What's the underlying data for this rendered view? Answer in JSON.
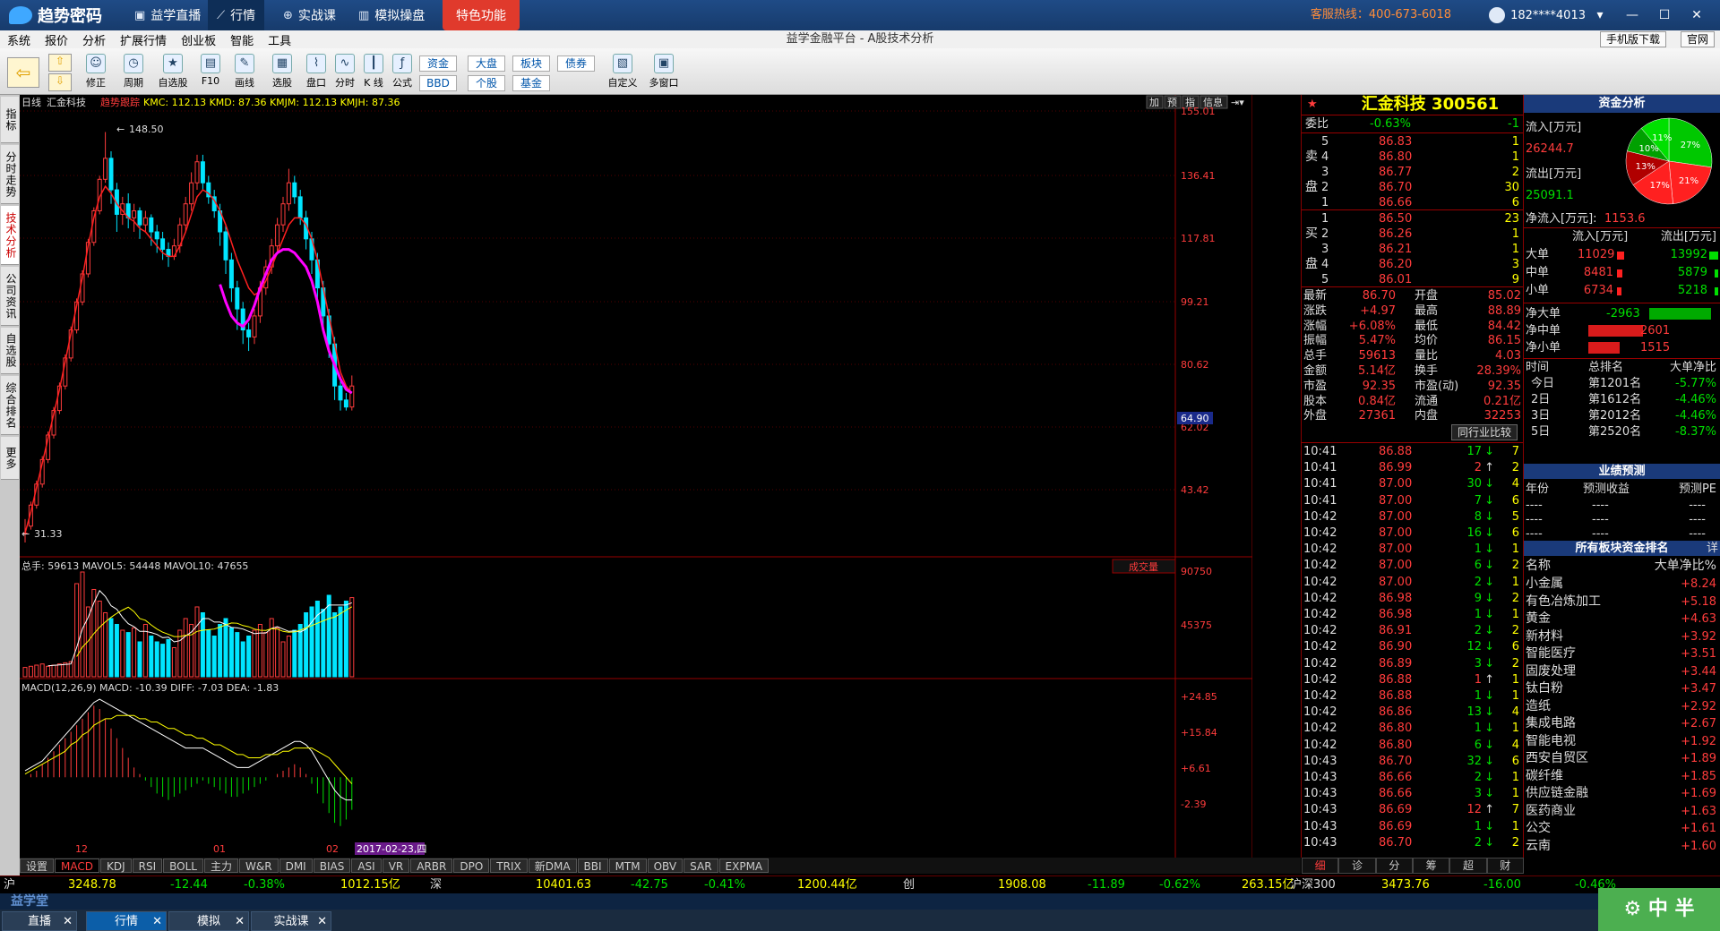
{
  "header": {
    "logo_text": "趋势密码",
    "nav": [
      "益学直播",
      "行情",
      "实战课",
      "模拟操盘"
    ],
    "special": "特色功能",
    "hotline": "客服热线：400-673-6018",
    "user": "182****4013",
    "window_controls": [
      "▾",
      "—",
      "☐",
      "✕"
    ]
  },
  "menu": {
    "items": [
      "系统",
      "报价",
      "分析",
      "扩展行情",
      "创业板",
      "智能",
      "工具"
    ],
    "platform_title": "益学金融平台 - A股技术分析",
    "right_buttons": [
      "手机版下载",
      "官网"
    ]
  },
  "toolbar": {
    "buttons": [
      "修正",
      "周期",
      "自选股",
      "F10",
      "画线",
      "选股",
      "盘口",
      "分时",
      "K 线",
      "公式"
    ],
    "small": [
      "资金",
      "BBD",
      "大盘",
      "个股",
      "板块",
      "基金",
      "债券"
    ],
    "right": [
      "自定义",
      "多窗口"
    ]
  },
  "left_tabs": [
    "指标",
    "分时走势",
    "技术分析",
    "公司资讯",
    "自选股",
    "综合排名",
    "更多"
  ],
  "chart": {
    "title_row": {
      "period": "日线",
      "name": "汇金科技",
      "indicator": "趋势跟踪",
      "values": "KMC: 112.13  KMD: 87.36  KMJM: 112.13  KMJH: 87.36"
    },
    "top_buttons": [
      "加",
      "预",
      "指",
      "信息"
    ],
    "price_axis": [
      "155.01",
      "136.41",
      "117.81",
      "99.21",
      "80.62",
      "62.02",
      "43.42"
    ],
    "current_price_tag": "64.90",
    "high_label": "148.50",
    "low_label": "31.33",
    "vol_header": "总手: 59613  MAVOL5: 54448  MAVOL10: 47655",
    "vol_selector": "成交量",
    "vol_axis": [
      "90750",
      "45375"
    ],
    "macd_header": "MACD(12,26,9)  MACD: -10.39  DIFF: -7.03  DEA: -1.83",
    "macd_axis": [
      "+24.85",
      "+15.84",
      "+6.61",
      "-2.39"
    ],
    "x_labels": [
      "12",
      "01",
      "02"
    ],
    "cursor_date": "2017-02-23,四"
  },
  "chart_data": {
    "type": "candlestick",
    "ylim": [
      31.33,
      155.01
    ],
    "candles": [
      [
        34,
        34,
        31.33,
        38
      ],
      [
        36,
        42,
        35,
        43
      ],
      [
        42,
        48,
        41,
        49
      ],
      [
        48,
        55,
        47,
        56
      ],
      [
        55,
        62,
        54,
        63
      ],
      [
        62,
        69,
        61,
        70
      ],
      [
        69,
        76,
        68,
        77
      ],
      [
        76,
        84,
        75,
        85
      ],
      [
        84,
        92,
        83,
        93
      ],
      [
        92,
        100,
        91,
        101
      ],
      [
        100,
        108,
        99,
        109
      ],
      [
        108,
        117,
        107,
        118
      ],
      [
        117,
        126,
        116,
        127
      ],
      [
        126,
        135,
        125,
        136
      ],
      [
        135,
        141,
        134,
        148.5
      ],
      [
        141,
        132,
        128,
        143
      ],
      [
        132,
        125,
        120,
        134
      ],
      [
        125,
        128,
        122,
        130
      ],
      [
        128,
        124,
        121,
        131
      ],
      [
        124,
        126,
        120,
        128
      ],
      [
        126,
        122,
        118,
        127
      ],
      [
        122,
        124,
        120,
        126
      ],
      [
        124,
        120,
        116,
        125
      ],
      [
        120,
        118,
        114,
        122
      ],
      [
        118,
        115,
        112,
        120
      ],
      [
        115,
        113,
        110,
        117
      ],
      [
        113,
        116,
        112,
        118
      ],
      [
        116,
        122,
        114,
        124
      ],
      [
        122,
        128,
        120,
        130
      ],
      [
        128,
        134,
        126,
        137
      ],
      [
        134,
        140,
        132,
        142
      ],
      [
        140,
        134,
        132,
        142
      ],
      [
        134,
        130,
        128,
        136
      ],
      [
        130,
        126,
        124,
        132
      ],
      [
        126,
        120,
        116,
        128
      ],
      [
        120,
        112,
        108,
        122
      ],
      [
        112,
        104,
        100,
        114
      ],
      [
        104,
        98,
        92,
        106
      ],
      [
        98,
        92,
        88,
        100
      ],
      [
        92,
        90,
        86,
        94
      ],
      [
        90,
        96,
        88,
        98
      ],
      [
        96,
        104,
        94,
        106
      ],
      [
        104,
        110,
        102,
        112
      ],
      [
        110,
        116,
        108,
        118
      ],
      [
        116,
        122,
        114,
        124
      ],
      [
        122,
        128,
        120,
        130
      ],
      [
        128,
        134,
        126,
        138
      ],
      [
        134,
        130,
        128,
        136
      ],
      [
        130,
        124,
        122,
        132
      ],
      [
        124,
        118,
        115,
        126
      ],
      [
        118,
        112,
        108,
        120
      ],
      [
        112,
        104,
        100,
        114
      ],
      [
        104,
        96,
        92,
        106
      ],
      [
        96,
        88,
        84,
        98
      ],
      [
        88,
        76,
        72,
        90
      ],
      [
        76,
        72,
        69,
        78
      ],
      [
        72,
        70,
        69,
        74
      ],
      [
        70,
        76,
        69,
        79
      ]
    ],
    "kmc": [
      34,
      40,
      47,
      54,
      61,
      68,
      75,
      83,
      91,
      99,
      107,
      116,
      124,
      130,
      133,
      131,
      128,
      126,
      124,
      123,
      121,
      120,
      118,
      116,
      114,
      113,
      113,
      116,
      120,
      125,
      130,
      132,
      131,
      129,
      126,
      122,
      117,
      112,
      108,
      104,
      102,
      103,
      106,
      110,
      114,
      118,
      122,
      124,
      124,
      122,
      118,
      112,
      104,
      96,
      88,
      80,
      76,
      74
    ],
    "kmd": [
      null,
      null,
      null,
      null,
      null,
      null,
      null,
      null,
      null,
      null,
      null,
      null,
      null,
      null,
      null,
      null,
      null,
      null,
      null,
      null,
      null,
      null,
      null,
      null,
      null,
      null,
      null,
      null,
      null,
      null,
      null,
      null,
      null,
      null,
      105,
      100,
      96,
      94,
      93,
      95,
      99,
      104,
      108,
      112,
      114,
      115,
      115,
      114,
      112,
      110,
      106,
      100,
      92,
      86,
      82,
      78,
      75,
      74
    ],
    "volume": [
      8000,
      9000,
      10000,
      11000,
      9000,
      10000,
      11000,
      12000,
      13000,
      80000,
      90000,
      60000,
      75000,
      65000,
      55000,
      50000,
      45000,
      40000,
      38000,
      42000,
      30000,
      45000,
      35000,
      30000,
      28000,
      32000,
      25000,
      40000,
      50000,
      45000,
      60000,
      55000,
      40000,
      35000,
      45000,
      50000,
      42000,
      38000,
      30000,
      35000,
      40000,
      45000,
      38000,
      50000,
      42000,
      30000,
      35000,
      40000,
      45000,
      55000,
      60000,
      65000,
      58000,
      70000,
      55000,
      60000,
      65000,
      68000
    ],
    "macd_hist": [
      0,
      1,
      2,
      4,
      6,
      8,
      10,
      12,
      14,
      16,
      18,
      20,
      22,
      21,
      18,
      15,
      12,
      9,
      6,
      3,
      1,
      -1,
      -3,
      -5,
      -6,
      -7,
      -6,
      -5,
      -4,
      -3,
      -2,
      -1,
      -2,
      -3,
      -4,
      -5,
      -6,
      -6,
      -5,
      -4,
      -3,
      -2,
      -1,
      0,
      1,
      2,
      3,
      4,
      3,
      1,
      -2,
      -5,
      -8,
      -11,
      -14,
      -15,
      -13,
      -10
    ],
    "macd_diff": [
      2,
      3,
      4,
      5,
      7,
      9,
      11,
      13,
      15,
      17,
      19,
      21,
      23,
      24,
      23,
      22,
      21,
      20,
      19,
      18,
      17,
      16,
      15,
      14,
      13,
      12,
      11,
      10,
      9,
      9,
      9,
      9,
      8,
      7,
      6,
      5,
      4,
      3,
      3,
      3,
      4,
      5,
      6,
      7,
      8,
      9,
      10,
      11,
      11,
      10,
      8,
      5,
      2,
      -1,
      -4,
      -6,
      -7,
      -7
    ],
    "macd_dea": [
      1,
      2,
      3,
      4,
      5,
      6,
      7,
      8,
      10,
      11,
      13,
      14,
      16,
      17,
      18,
      18,
      19,
      19,
      19,
      19,
      18,
      18,
      17,
      17,
      16,
      15,
      15,
      14,
      13,
      13,
      12,
      12,
      11,
      10,
      10,
      9,
      8,
      7,
      7,
      6,
      6,
      6,
      7,
      7,
      7,
      8,
      8,
      9,
      9,
      9,
      9,
      8,
      7,
      6,
      4,
      2,
      0,
      -2
    ]
  },
  "quote": {
    "title": "汇金科技 300561",
    "weibi_label": "委比",
    "weibi_value": "-0.63%",
    "weibi_diff": "-1",
    "sell_label": [
      "卖",
      "盘"
    ],
    "buy_label": [
      "买",
      "盘"
    ],
    "asks": [
      [
        "5",
        "86.83",
        "1"
      ],
      [
        "4",
        "86.80",
        "1"
      ],
      [
        "3",
        "86.77",
        "2"
      ],
      [
        "2",
        "86.70",
        "30"
      ],
      [
        "1",
        "86.66",
        "6"
      ]
    ],
    "bids": [
      [
        "1",
        "86.50",
        "23"
      ],
      [
        "2",
        "86.26",
        "1"
      ],
      [
        "3",
        "86.21",
        "1"
      ],
      [
        "4",
        "86.20",
        "3"
      ],
      [
        "5",
        "86.01",
        "9"
      ]
    ],
    "stats": [
      [
        "最新",
        "86.70",
        "开盘",
        "85.02"
      ],
      [
        "涨跌",
        "+4.97",
        "最高",
        "88.89"
      ],
      [
        "涨幅",
        "+6.08%",
        "最低",
        "84.42"
      ],
      [
        "振幅",
        "5.47%",
        "均价",
        "86.15"
      ],
      [
        "总手",
        "59613",
        "量比",
        "4.03"
      ],
      [
        "金额",
        "5.14亿",
        "换手",
        "28.39%"
      ],
      [
        "市盈",
        "92.35",
        "市盈(动)",
        "92.35"
      ],
      [
        "股本",
        "0.84亿",
        "流通",
        "0.21亿"
      ],
      [
        "外盘",
        "27361",
        "内盘",
        "32253"
      ]
    ],
    "peer_button": "同行业比较",
    "ticks": [
      [
        "10:41",
        "86.88",
        "17",
        "↓",
        "7"
      ],
      [
        "10:41",
        "86.99",
        "2",
        "↑",
        "2"
      ],
      [
        "10:41",
        "87.00",
        "30",
        "↓",
        "4"
      ],
      [
        "10:41",
        "87.00",
        "7",
        "↓",
        "6"
      ],
      [
        "10:42",
        "87.00",
        "8",
        "↓",
        "5"
      ],
      [
        "10:42",
        "87.00",
        "16",
        "↓",
        "6"
      ],
      [
        "10:42",
        "87.00",
        "1",
        "↓",
        "1"
      ],
      [
        "10:42",
        "87.00",
        "6",
        "↓",
        "2"
      ],
      [
        "10:42",
        "87.00",
        "2",
        "↓",
        "1"
      ],
      [
        "10:42",
        "86.98",
        "9",
        "↓",
        "2"
      ],
      [
        "10:42",
        "86.98",
        "1",
        "↓",
        "1"
      ],
      [
        "10:42",
        "86.91",
        "2",
        "↓",
        "2"
      ],
      [
        "10:42",
        "86.90",
        "12",
        "↓",
        "6"
      ],
      [
        "10:42",
        "86.89",
        "3",
        "↓",
        "2"
      ],
      [
        "10:42",
        "86.88",
        "1",
        "↑",
        "1"
      ],
      [
        "10:42",
        "86.88",
        "1",
        "↓",
        "1"
      ],
      [
        "10:42",
        "86.86",
        "13",
        "↓",
        "4"
      ],
      [
        "10:42",
        "86.80",
        "1",
        "↓",
        "1"
      ],
      [
        "10:42",
        "86.80",
        "6",
        "↓",
        "4"
      ],
      [
        "10:43",
        "86.70",
        "32",
        "↓",
        "6"
      ],
      [
        "10:43",
        "86.66",
        "2",
        "↓",
        "1"
      ],
      [
        "10:43",
        "86.66",
        "3",
        "↓",
        "1"
      ],
      [
        "10:43",
        "86.69",
        "12",
        "↑",
        "7"
      ],
      [
        "10:43",
        "86.69",
        "1",
        "↓",
        "1"
      ],
      [
        "10:43",
        "86.70",
        "2",
        "↓",
        "2"
      ]
    ],
    "bottom_tabs": [
      "细",
      "诊",
      "分",
      "筹",
      "超",
      "财"
    ]
  },
  "fund": {
    "title": "资金分析",
    "inflow_label": "流入[万元]",
    "inflow_value": "26244.7",
    "outflow_label": "流出[万元]",
    "outflow_value": "25091.1",
    "net_label": "净流入[万元]:",
    "net_value": "1153.6",
    "pie": [
      {
        "v": 27,
        "c": "#00c800"
      },
      {
        "v": 21,
        "c": "#ff2020"
      },
      {
        "v": 17,
        "c": "#ff2020"
      },
      {
        "v": 13,
        "c": "#b00000"
      },
      {
        "v": 10,
        "c": "#00a000"
      },
      {
        "v": 11,
        "c": "#00e000"
      }
    ],
    "pie_labels": [
      "27%",
      "21%",
      "17%",
      "13%",
      "10%",
      "11%"
    ],
    "flow_header": [
      "流入[万元]",
      "流出[万元]"
    ],
    "flows": [
      [
        "大单",
        "11029",
        "13992"
      ],
      [
        "中单",
        "8481",
        "5879"
      ],
      [
        "小单",
        "6734",
        "5218"
      ]
    ],
    "net_items": [
      [
        "净大单",
        "-2963"
      ],
      [
        "净中单",
        "2601"
      ],
      [
        "净小单",
        "1515"
      ]
    ],
    "rank_header": [
      "时间",
      "总排名",
      "大单净比"
    ],
    "ranks": [
      [
        "今日",
        "第1201名",
        "-5.77%"
      ],
      [
        "2日",
        "第1612名",
        "-4.46%"
      ],
      [
        "3日",
        "第2012名",
        "-4.46%"
      ],
      [
        "5日",
        "第2520名",
        "-8.37%"
      ]
    ],
    "forecast_title": "业绩预测",
    "forecast_header": [
      "年份",
      "预测收益",
      "预测PE"
    ],
    "forecast_rows": [
      [
        "----",
        "----",
        "----"
      ],
      [
        "----",
        "----",
        "----"
      ],
      [
        "----",
        "----",
        "----"
      ]
    ],
    "sector_title": "所有板块资金排名",
    "sector_detail": "详",
    "sector_header": [
      "名称",
      "大单净比%"
    ],
    "sectors": [
      [
        "小金属",
        "+8.24"
      ],
      [
        "有色冶炼加工",
        "+5.18"
      ],
      [
        "黄金",
        "+4.63"
      ],
      [
        "新材料",
        "+3.92"
      ],
      [
        "智能医疗",
        "+3.51"
      ],
      [
        "固废处理",
        "+3.44"
      ],
      [
        "钛白粉",
        "+3.47"
      ],
      [
        "造纸",
        "+2.92"
      ],
      [
        "集成电路",
        "+2.67"
      ],
      [
        "智能电视",
        "+1.92"
      ],
      [
        "西安自贸区",
        "+1.89"
      ],
      [
        "碳纤维",
        "+1.85"
      ],
      [
        "供应链金融",
        "+1.69"
      ],
      [
        "医药商业",
        "+1.63"
      ],
      [
        "公交",
        "+1.61"
      ],
      [
        "云南",
        "+1.60"
      ]
    ]
  },
  "indicator_tabs": [
    "设置",
    "MACD",
    "KDJ",
    "RSI",
    "BOLL",
    "主力",
    "W&R",
    "DMI",
    "BIAS",
    "ASI",
    "VR",
    "ARBR",
    "DPO",
    "TRIX",
    "新DMA",
    "BBI",
    "MTM",
    "OBV",
    "SAR",
    "EXPMA"
  ],
  "ticker": [
    [
      "沪",
      "3248.78",
      "-12.44",
      "-0.38%",
      "1012.15亿"
    ],
    [
      "深",
      "10401.63",
      "-42.75",
      "-0.41%",
      "1200.44亿"
    ],
    [
      "创",
      "1908.08",
      "-11.89",
      "-0.62%",
      "263.15亿"
    ],
    [
      "沪深300",
      "3473.76",
      "-16.00",
      "-0.46%",
      ""
    ]
  ],
  "footer_brand": "益学堂",
  "taskbar": [
    "直播",
    "行情",
    "模拟",
    "实战课"
  ],
  "bottom_right": "中 半"
}
